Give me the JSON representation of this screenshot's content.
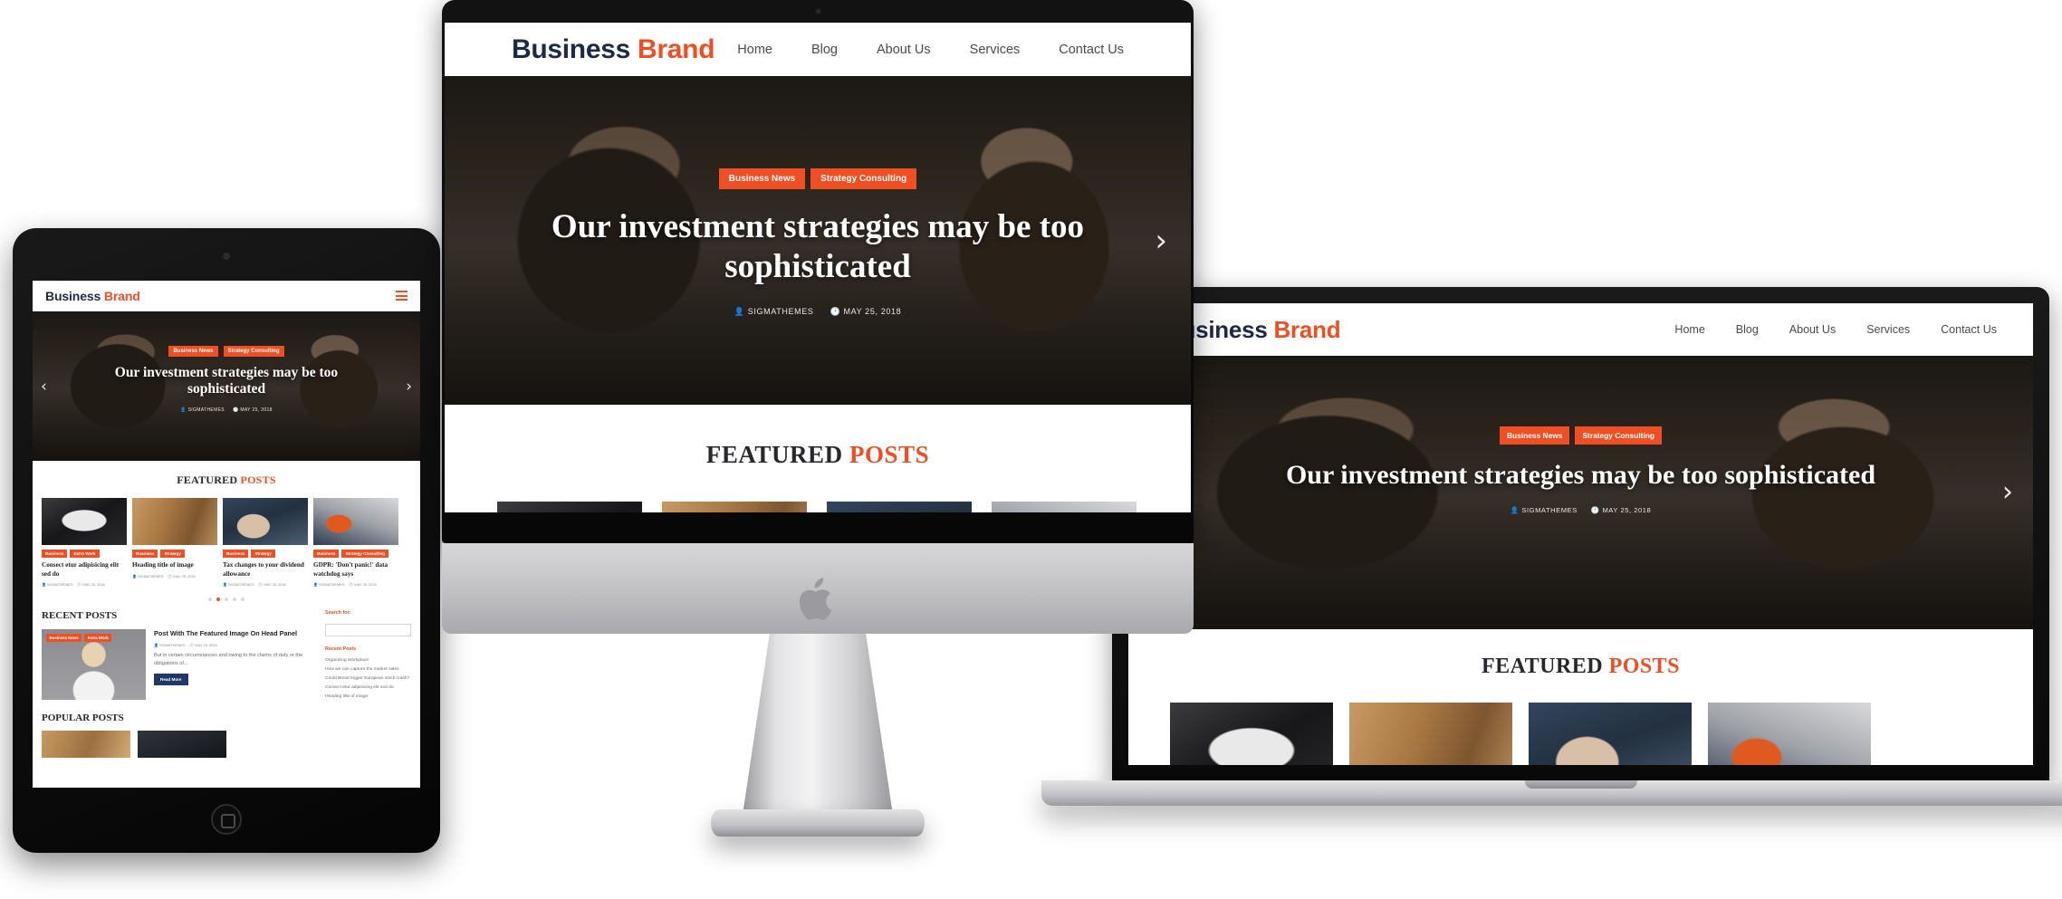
{
  "brand": {
    "first": "Business",
    "second": "Brand"
  },
  "colors": {
    "accent": "#f04e23",
    "logo_dark": "#1b2a4a",
    "heading": "#27272e",
    "button": "#1f3864"
  },
  "nav": {
    "items": [
      {
        "label": "Home"
      },
      {
        "label": "Blog"
      },
      {
        "label": "About Us"
      },
      {
        "label": "Services"
      },
      {
        "label": "Contact Us"
      }
    ],
    "mobile_toggle_icon": "hamburger-icon"
  },
  "hero": {
    "badges": [
      "Business News",
      "Strategy Consulting"
    ],
    "title": "Our investment strategies may be too sophisticated",
    "author": "SIGMATHEMES",
    "date": "MAY 25, 2018",
    "author_icon": "user-icon",
    "date_icon": "clock-icon",
    "next_arrow": "›",
    "prev_arrow": "‹"
  },
  "featured": {
    "heading_first": "FEATURED",
    "heading_second": "POSTS",
    "cards": [
      {
        "badges": [
          "Business",
          "Extra Work"
        ],
        "title": "Consect etur adipisicing elit sed do",
        "author": "SIGMATHEMES",
        "date": "MAY 25, 2018",
        "photo": "ph-sketch"
      },
      {
        "badges": [
          "Business",
          "Strategy"
        ],
        "title": "Heading title of image",
        "author": "SIGMATHEMES",
        "date": "MAY 25, 2018",
        "photo": "ph-desk"
      },
      {
        "badges": [
          "Business",
          "Strategy"
        ],
        "title": "Tax changes to your dividend allowance",
        "author": "SIGMATHEMES",
        "date": "MAY 25, 2018",
        "photo": "ph-hands"
      },
      {
        "badges": [
          "Business",
          "Strategy Consulting"
        ],
        "title": "GDPR: 'Don't panic!' data watchdog says",
        "author": "SIGMATHEMES",
        "date": "MAY 25, 2018",
        "photo": "ph-phone"
      }
    ],
    "dots": 5,
    "active_dot": 1
  },
  "recent": {
    "heading": "RECENT POSTS",
    "post": {
      "badges": [
        "Business News",
        "Extra Work"
      ],
      "title": "Post With The Featured Image On Head Panel",
      "author": "SIGMATHEMES",
      "date": "MAY 25, 2018",
      "excerpt": "But in certain circumstances and owing to the claims of duty or the obligations of...",
      "button": "Read More"
    }
  },
  "popular": {
    "heading": "POPULAR POSTS"
  },
  "sidebar": {
    "search_label": "Search for:",
    "search_value": "",
    "recent_heading": "Recent Posts",
    "recent_items": [
      "Organizing Workplace",
      "How we can capture the market sales",
      "Could Brexit trigger European stock crash?",
      "Consect etur adipisicing elit sed do",
      "Heading title of image"
    ]
  },
  "devices": {
    "desktop": "imac-desktop-mockup",
    "tablet": "ipad-tablet-mockup",
    "laptop": "macbook-laptop-mockup"
  }
}
